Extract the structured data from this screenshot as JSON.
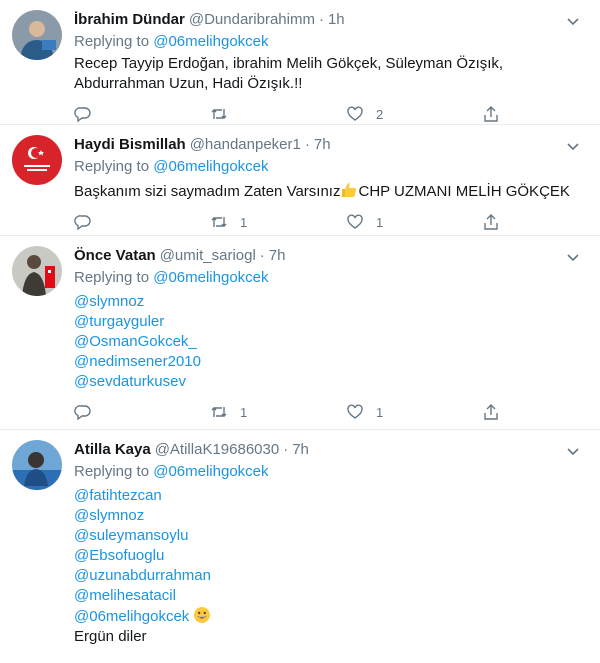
{
  "replying_prefix": "Replying to",
  "tweets": [
    {
      "name": "İbrahim Dündar",
      "handle": "@Dundaribrahimm",
      "time": "1h",
      "replying_to": "@06melihgokcek",
      "text_lines": [
        "Recep Tayyip Erdoğan, ibrahim Melih Gökçek, Süleyman Özışık,",
        "Abdurrahman Uzun, Hadi Özışık.!!"
      ],
      "counts": {
        "reply": "",
        "retweet": "",
        "like": "2"
      }
    },
    {
      "name": "Haydi Bismillah",
      "handle": "@handanpeker1",
      "time": "7h",
      "replying_to": "@06melihgokcek",
      "text_before": "Başkanım sizi saymadım Zaten Varsınız",
      "emoji": "thumbs-up-icon",
      "text_after": "CHP UZMANI MELİH GÖKÇEK",
      "counts": {
        "reply": "",
        "retweet": "1",
        "like": "1"
      }
    },
    {
      "name": "Önce Vatan",
      "handle": "@umit_sariogl",
      "time": "7h",
      "replying_to": "@06melihgokcek",
      "mentions": [
        "@slymnoz",
        "@turgayguler",
        "@OsmanGokcek_",
        "@nedimsener2010",
        "@sevdaturkusev"
      ],
      "counts": {
        "reply": "",
        "retweet": "1",
        "like": "1"
      }
    },
    {
      "name": "Atilla Kaya",
      "handle": "@AtillaK19686030",
      "time": "7h",
      "replying_to": "@06melihgokcek",
      "mentions": [
        "@fatihtezcan",
        "@slymnoz",
        "@suleymansoylu",
        "@Ebsofuoglu",
        "@uzunabdurrahman",
        "@melihesatacil",
        "@06melihgokcek"
      ],
      "emoji": "grinning-face-icon",
      "extra_text": "Ergün diler"
    }
  ],
  "colors": {
    "accent": "#1b95e0",
    "muted": "#657786",
    "text": "#14171a",
    "divider": "#e6ecf0"
  }
}
